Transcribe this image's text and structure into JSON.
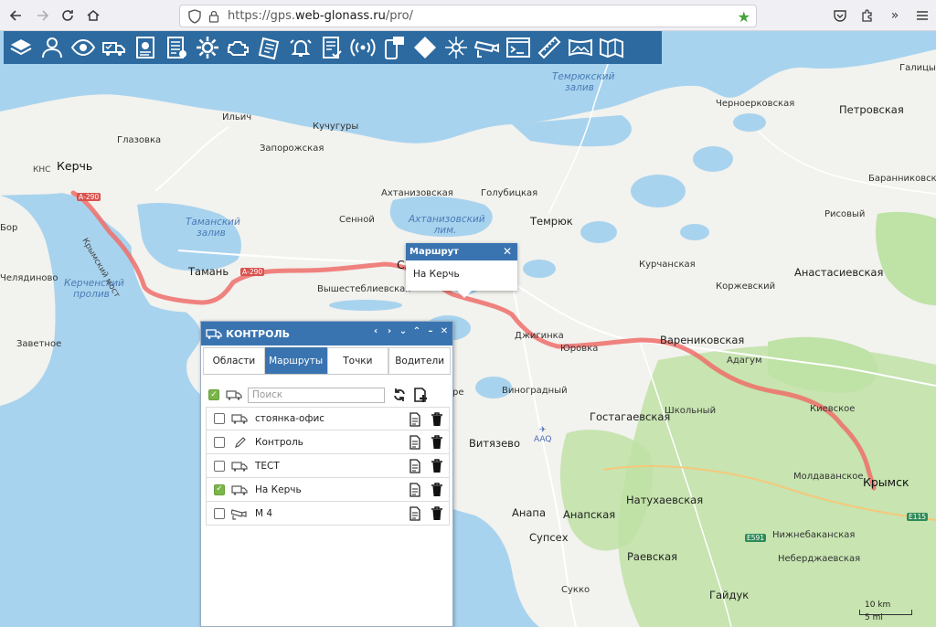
{
  "browser": {
    "url_prefix": "https://gps.",
    "url_domain": "web-glonass.ru",
    "url_path": "/pro/"
  },
  "toolbar": {
    "icons": [
      "layers-icon",
      "user-icon",
      "eye-icon",
      "truck-checklist-icon",
      "report-chart-icon",
      "document-list-icon",
      "gear-icon",
      "engine-icon",
      "clipboard-icon",
      "alarm-bell-icon",
      "document-check-icon",
      "signal-icon",
      "phone-message-icon",
      "diamond-icon",
      "network-hub-icon",
      "camera-icon",
      "terminal-icon",
      "ruler-icon",
      "panorama-icon",
      "map-icon"
    ]
  },
  "map": {
    "labels": [
      {
        "text": "Керчь",
        "cls": "city"
      },
      {
        "text": "Глазовка",
        "cls": ""
      },
      {
        "text": "КНС",
        "cls": "road"
      },
      {
        "text": "Ильич",
        "cls": ""
      },
      {
        "text": "Кучугуры",
        "cls": ""
      },
      {
        "text": "Запорожская",
        "cls": ""
      },
      {
        "text": "Черноерковская",
        "cls": ""
      },
      {
        "text": "Петровская",
        "cls": "big"
      },
      {
        "text": "Галицын",
        "cls": ""
      },
      {
        "text": "Баранниковский",
        "cls": ""
      },
      {
        "text": "Ахтанизовская",
        "cls": ""
      },
      {
        "text": "Голубицкая",
        "cls": ""
      },
      {
        "text": "Сенной",
        "cls": ""
      },
      {
        "text": "Темрюк",
        "cls": "big"
      },
      {
        "text": "Рисовый",
        "cls": ""
      },
      {
        "text": "Тамань",
        "cls": "big"
      },
      {
        "text": "Вышестеблиевская",
        "cls": ""
      },
      {
        "text": "Курчанская",
        "cls": ""
      },
      {
        "text": "Анастасиевская",
        "cls": "big"
      },
      {
        "text": "Коржевский",
        "cls": ""
      },
      {
        "text": "Челядиново",
        "cls": ""
      },
      {
        "text": "Заветное",
        "cls": ""
      },
      {
        "text": "Джигинка",
        "cls": ""
      },
      {
        "text": "Юровка",
        "cls": ""
      },
      {
        "text": "Варениковская",
        "cls": "big"
      },
      {
        "text": "Адагум",
        "cls": ""
      },
      {
        "text": "Виноградный",
        "cls": ""
      },
      {
        "text": "Школьный",
        "cls": ""
      },
      {
        "text": "Гостагаевская",
        "cls": "big"
      },
      {
        "text": "Киевское",
        "cls": ""
      },
      {
        "text": "Витязево",
        "cls": "big"
      },
      {
        "text": "AAQ",
        "cls": "road"
      },
      {
        "text": "Молдаванское",
        "cls": ""
      },
      {
        "text": "Крымск",
        "cls": "city"
      },
      {
        "text": "Натухаевская",
        "cls": "big"
      },
      {
        "text": "Анапа",
        "cls": "big"
      },
      {
        "text": "Анапская",
        "cls": "big"
      },
      {
        "text": "Супсех",
        "cls": "big"
      },
      {
        "text": "Нижнебаканская",
        "cls": ""
      },
      {
        "text": "Раевская",
        "cls": "big"
      },
      {
        "text": "Неберджаевская",
        "cls": ""
      },
      {
        "text": "Сукко",
        "cls": ""
      },
      {
        "text": "Гайдук",
        "cls": "big"
      },
      {
        "text": "Бор",
        "cls": ""
      },
      {
        "text": "Вере",
        "cls": ""
      },
      {
        "text": "Сл",
        "cls": "city"
      }
    ],
    "water_labels": [
      "Темрюкский залив",
      "Таманский залив",
      "Ахтанизовский лим.",
      "Керченский пролив"
    ],
    "bridge_label": "Крымский мост",
    "shields": [
      "А-290",
      "А-290",
      "Е591",
      "Е115"
    ],
    "scale": {
      "km": "10 km",
      "mi": "5 mi"
    }
  },
  "popup": {
    "title": "Маршрут",
    "body": "На Керчь",
    "close": "✕"
  },
  "panel": {
    "title": "КОНТРОЛЬ",
    "controls": [
      "‹",
      "›",
      "⌄",
      "⌃",
      "–",
      "✕"
    ],
    "tabs": [
      "Области",
      "Маршруты",
      "Точки",
      "Водители"
    ],
    "active_tab": 1,
    "search_placeholder": "Поиск",
    "select_all_checked": true,
    "items": [
      {
        "name": "стоянка-офис",
        "icon": "truck-icon",
        "checked": false
      },
      {
        "name": "Контроль",
        "icon": "pencil-icon",
        "checked": false
      },
      {
        "name": "ТЕСТ",
        "icon": "truck-icon",
        "checked": false
      },
      {
        "name": "На Керчь",
        "icon": "truck-icon",
        "checked": true
      },
      {
        "name": "М 4",
        "icon": "camera-icon",
        "checked": false
      }
    ]
  },
  "colors": {
    "toolbar": "#2d6a9f",
    "accent": "#3a74b0",
    "route": "#ee6f6a",
    "sea": "#a8d3ee",
    "land": "#f2f2ee",
    "forest": "#bfe2a6",
    "check": "#7ab648"
  }
}
